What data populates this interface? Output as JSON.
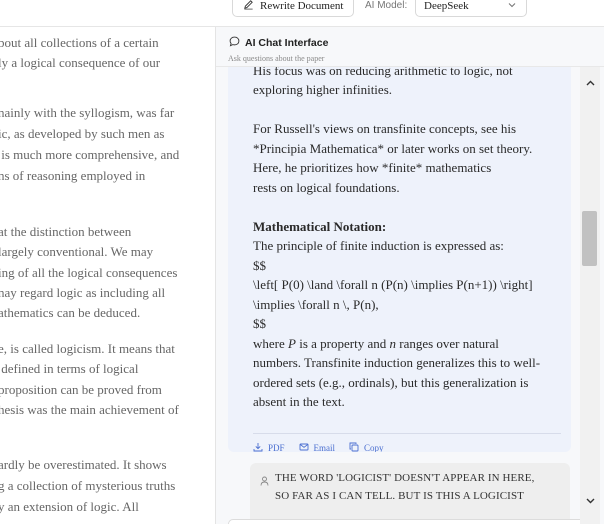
{
  "toolbar": {
    "rewrite_label": "Rewrite Document",
    "ai_model_label": "AI Model:",
    "model_value": "DeepSeek"
  },
  "document": {
    "lines": [
      "bout all collections of a certain",
      "ly a logical consequence of our",
      "",
      "nainly with the syllogism, was far",
      "ic, as developed by such men as",
      " is much more comprehensive, and",
      "ns of reasoning employed in",
      "",
      "at the distinction between",
      "largely conventional. We may",
      "ing of all the logical consequences",
      "nay regard logic as including all",
      "athematics can be deduced.",
      "",
      "e, is called logicism. It means that",
      " defined in terms of logical",
      "proposition can be proved from",
      "hesis was the main achievement of",
      "",
      "",
      "ardly be overestimated. It shows",
      "g a collection of mysterious truths",
      "y an extension of logic. All"
    ]
  },
  "chat": {
    "title": "AI Chat Interface",
    "subtitle": "Ask questions about the paper",
    "message": {
      "lines": [
        "His focus was on reducing arithmetic to logic, not",
        "exploring higher infinities.",
        "",
        "For Russell's views on transfinite concepts, see his",
        "*Principia Mathematica* or later works on set theory.",
        "Here, he prioritizes how *finite* mathematics",
        "rests on logical foundations.",
        "",
        "Mathematical Notation:",
        "The principle of finite induction is expressed as:",
        "$$",
        "\\left[ P(0) \\land \\forall n (P(n) \\implies P(n+1)) \\right]",
        "\\implies \\forall n \\, P(n),",
        "$$",
        "where P is a property and n ranges over natural",
        "numbers. Transfinite induction generalizes this to well-",
        "ordered sets (e.g., ordinals), but this generalization is",
        "absent in the text."
      ]
    },
    "actions": {
      "pdf": "PDF",
      "email": "Email",
      "copy": "Copy"
    },
    "user_message": {
      "lines": [
        "THE WORD 'LOGICIST' DOESN'T APPEAR IN HERE,",
        "SO FAR AS I CAN TELL. BUT IS THIS A LOGICIST"
      ]
    }
  },
  "icons": {
    "rewrite": "pencil-icon",
    "model_dropdown": "chevron-down-icon",
    "chat": "chat-bubble-icon",
    "pdf": "download-icon",
    "email": "mail-icon",
    "copy": "copy-icon",
    "user": "user-icon",
    "scroll_up": "chevron-up-icon",
    "scroll_down": "chevron-down-icon"
  },
  "colors": {
    "accent": "#4b6fd0",
    "assistant_bubble": "#eef2fb",
    "user_bubble": "#eeeeee"
  }
}
